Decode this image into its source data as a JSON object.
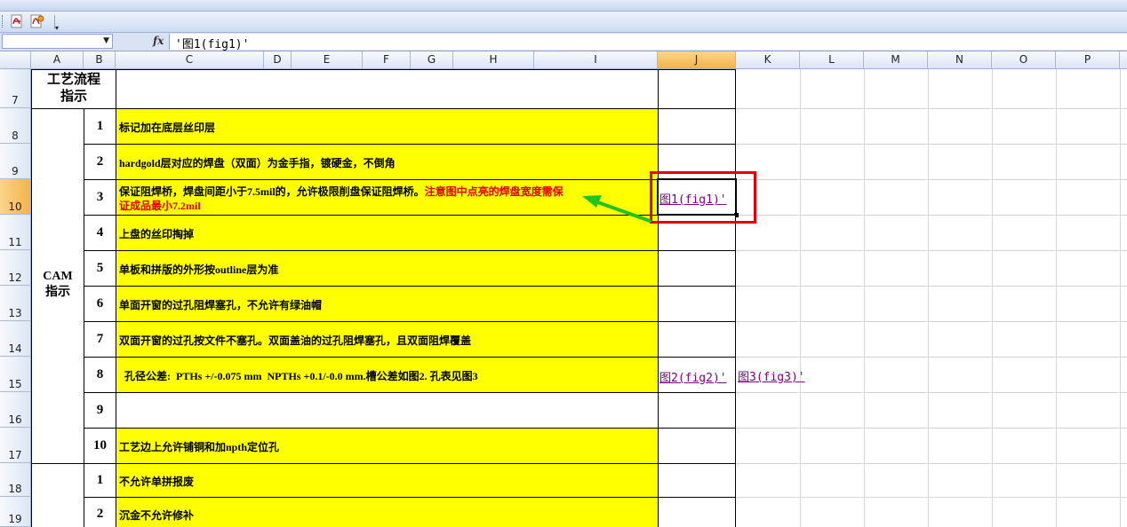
{
  "formula_bar": {
    "name_box": "",
    "fx_label": "fx",
    "content": "'图1(fig1)'"
  },
  "columns": [
    "A",
    "B",
    "C",
    "D",
    "E",
    "F",
    "G",
    "H",
    "I",
    "J",
    "K",
    "L",
    "M",
    "N",
    "O",
    "P"
  ],
  "selected_column": "J",
  "rows": [
    "7",
    "8",
    "9",
    "10",
    "11",
    "12",
    "13",
    "14",
    "15",
    "16",
    "17",
    "18",
    "19"
  ],
  "selected_row": "10",
  "sheet": {
    "header_label": "工艺流程\n指示",
    "group1_label": "CAM\n指示",
    "group1_items": [
      {
        "num": "1",
        "text": "标记加在底层丝印层"
      },
      {
        "num": "2",
        "text": "hardgold层对应的焊盘（双面）为金手指，镀硬金，不倒角"
      },
      {
        "num": "3",
        "text_black": "保证阻焊桥，焊盘间距小于7.5mil的，允许极限削盘保证阻焊桥。",
        "text_red_1": "注意图中点亮的焊盘宽度需保",
        "text_red_2": "证成品最小7.2mil"
      },
      {
        "num": "4",
        "text": "上盘的丝印掏掉"
      },
      {
        "num": "5",
        "text": "单板和拼版的外形按outline层为准"
      },
      {
        "num": "6",
        "text": "单面开窗的过孔阻焊塞孔，不允许有绿油帽"
      },
      {
        "num": "7",
        "text": "双面开窗的过孔按文件不塞孔。双面盖油的过孔阻焊塞孔，且双面阻焊覆盖"
      },
      {
        "num": "8",
        "text": "  孔径公差:  PTHs +/-0.075 mm  NPTHs +0.1/-0.0 mm.槽公差如图2. 孔表见图3"
      },
      {
        "num": "9",
        "text": ""
      },
      {
        "num": "10",
        "text": "工艺边上允许铺铜和加npth定位孔"
      }
    ],
    "group2_items": [
      {
        "num": "1",
        "text": "不允许单拼报废"
      },
      {
        "num": "2",
        "text": "沉金不允许修补"
      }
    ],
    "links": {
      "fig1": "图1(fig1)'",
      "fig2": "图2(fig2)'",
      "fig3": "图3(fig3)'"
    }
  },
  "colors": {
    "highlight": "#ffff00",
    "annotation": "#e00000",
    "arrow": "#22c422",
    "link": "#800080"
  },
  "icons": [
    "pdf-icon",
    "pdf-settings-icon",
    "green-arrow-icon"
  ]
}
